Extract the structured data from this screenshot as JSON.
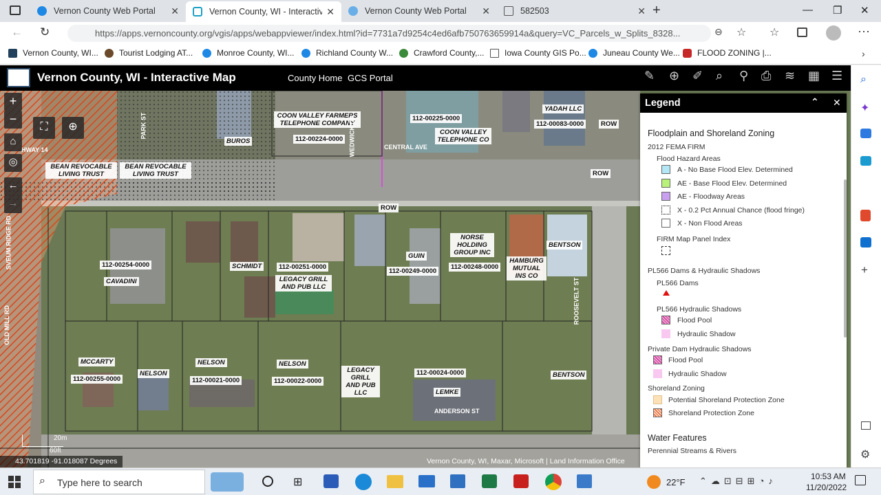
{
  "browser": {
    "tabs": [
      {
        "label": "Vernon County Web Portal",
        "active": false
      },
      {
        "label": "Vernon County, WI - Interactive",
        "active": true
      },
      {
        "label": "Vernon County Web Portal",
        "active": false
      },
      {
        "label": "582503",
        "active": false
      }
    ],
    "url": "https://apps.vernoncounty.org/vgis/apps/webappviewer/index.html?id=7731a7d9254c4ed6afb750763659914a&query=VC_Parcels_w_Splits_8328...",
    "bookmarks": [
      "Vernon County, WI...",
      "Tourist Lodging  AT...",
      "Monroe County, WI...",
      "Richland County W...",
      "Crawford County,...",
      "Iowa County GIS Po...",
      "Juneau County We...",
      "FLOOD ZONING |..."
    ]
  },
  "app": {
    "title": "Vernon County, WI - Interactive Map",
    "links": [
      "County Home",
      "GCS Portal"
    ]
  },
  "map": {
    "parcels": [
      "112-00224-0000",
      "112-00225-0000",
      "112-00083-0000",
      "112-00254-0000",
      "112-00251-0000",
      "112-00249-0000",
      "112-00248-0000",
      "112-00255-0000",
      "112-00021-0000",
      "112-00022-0000",
      "112-00024-0000"
    ],
    "owners": [
      "COON VALLEY FARMERS TELEPHONE COMPANY",
      "COON VALLEY TELEPHONE CO",
      "YADAH LLC",
      "BUROS",
      "BEAN REVOCABLE LIVING TRUST",
      "BEAN REVOCABLE LIVING TRUST",
      "SCHMIDT",
      "CAVADINI",
      "LEGACY GRILL AND PUB LLC",
      "GUIN",
      "NORSE HOLDING GROUP INC",
      "HAMBURG MUTUAL INS CO",
      "BENTSON",
      "MCCARTY",
      "NELSON",
      "NELSON",
      "NELSON",
      "LEGACY GRILL AND PUB LLC",
      "LEMKE",
      "BENTSON"
    ],
    "streets": [
      "CENTRAL AVE",
      "ROW",
      "ROW",
      "ROW",
      "ANDERSON ST",
      "ROOSEVELT ST",
      "PARK ST",
      "SVEUM RIDGE RD",
      "OLD MILL RD",
      "WEDWICK DR",
      "HWAY 14"
    ],
    "scale": {
      "metric": "20m",
      "imperial": "60ft"
    },
    "coords": "43.701819 -91.018087 Degrees",
    "attribution": "Vernon County, WI, Maxar, Microsoft | Land Information Office"
  },
  "legend": {
    "title": "Legend",
    "group": "Floodplain and Shoreland Zoning",
    "firm": "2012 FEMA FIRM",
    "flood_hazard": "Flood Hazard Areas",
    "items": [
      {
        "label": "A - No Base Flood Elev. Determined",
        "color": "#b3e7f5"
      },
      {
        "label": "AE - Base Flood Elev. Determined",
        "color": "#b9f27a"
      },
      {
        "label": "AE - Floodway Areas",
        "color": "#c9a0f0"
      },
      {
        "label": "X - 0.2 Pct Annual Chance (flood fringe)",
        "color": "#ffffff"
      },
      {
        "label": "X - Non Flood Areas",
        "color": "#ffffff"
      }
    ],
    "panel_index": "FIRM Map Panel Index",
    "dams_group": "PL566 Dams & Hydraulic Shadows",
    "dams": "PL566 Dams",
    "hydraulic_group": "PL566 Hydraulic Shadows",
    "flood_pool": "Flood Pool",
    "hydraulic_shadow": "Hydraulic Shadow",
    "private_group": "Private Dam Hydraulic Shadows",
    "private_flood_pool": "Flood Pool",
    "private_shadow": "Hydraulic Shadow",
    "shoreland": "Shoreland Zoning",
    "potential": "Potential Shoreland Protection Zone",
    "protection": "Shoreland Protection Zone",
    "water": "Water Features",
    "streams": "Perennial Streams & Rivers"
  },
  "taskbar": {
    "search": "Type here to search",
    "weather": "22°F",
    "time": "10:53 AM",
    "date": "11/20/2022"
  }
}
